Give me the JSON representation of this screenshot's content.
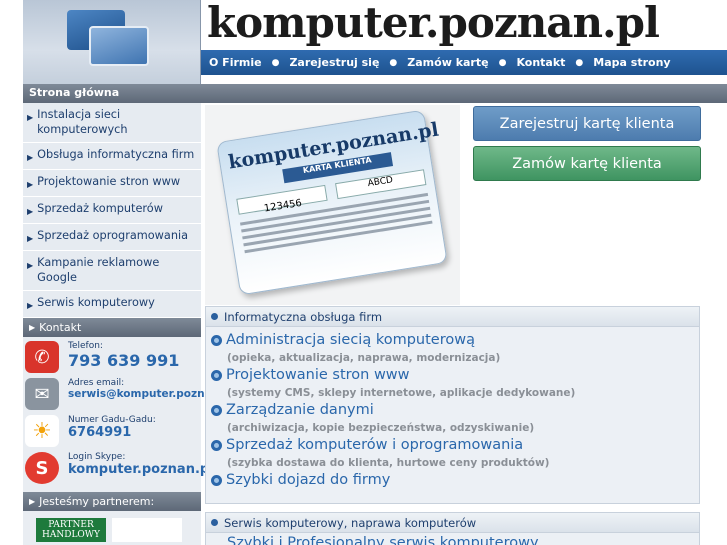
{
  "header": {
    "site_title": "komputer.poznan.pl",
    "nav": [
      "O Firmie",
      "Zarejestruj się",
      "Zamów kartę",
      "Kontakt",
      "Mapa strony"
    ]
  },
  "breadcrumb": "Strona główna",
  "sidebar": {
    "items": [
      "Instalacja sieci komputerowych",
      "Obsługa informatyczna firm",
      "Projektowanie stron www",
      "Sprzedaż komputerów",
      "Sprzedaż oprogramowania",
      "Kampanie reklamowe Google",
      "Serwis komputerowy"
    ],
    "contact_header": "Kontakt",
    "contact": {
      "phone_label": "Telefon:",
      "phone": "793 639 991",
      "email_label": "Adres email:",
      "email": "serwis@komputer.poznan.pl",
      "gg_label": "Numer Gadu-Gadu:",
      "gg": "6764991",
      "skype_label": "Login Skype:",
      "skype": "komputer.poznan.pl"
    },
    "partners_header": "Jesteśmy partnerem:",
    "partner_text": "PARTNER HANDLOWY"
  },
  "card": {
    "title": "komputer.poznan.pl",
    "subtitle": "KARTA KLIENTA",
    "number": "123456",
    "code": "ABCD"
  },
  "buttons": {
    "register": "Zarejestruj kartę klienta",
    "order": "Zamów kartę klienta"
  },
  "services": {
    "header": "Informatyczna obsługa firm",
    "items": [
      {
        "title": "Administracja siecią komputerową",
        "desc": "(opieka, aktualizacja, naprawa, modernizacja)"
      },
      {
        "title": "Projektowanie stron www",
        "desc": "(systemy CMS, sklepy internetowe, aplikacje dedykowane)"
      },
      {
        "title": "Zarządzanie danymi",
        "desc": "(archiwizacja, kopie bezpieczeństwa, odzyskiwanie)"
      },
      {
        "title": "Sprzedaż komputerów i oprogramowania",
        "desc": "(szybka dostawa do klienta, hurtowe ceny produktów)"
      },
      {
        "title": "Szybki dojazd do firmy",
        "desc": ""
      }
    ]
  },
  "services2": {
    "header": "Serwis komputerowy, naprawa komputerów",
    "first_item": "Szybki i Profesjonalny serwis komputerowy"
  },
  "colors": {
    "nav_blue": "#1e538f",
    "link_blue": "#2a67ab",
    "register_btn": "#5a88bb",
    "order_btn": "#4fa571"
  }
}
